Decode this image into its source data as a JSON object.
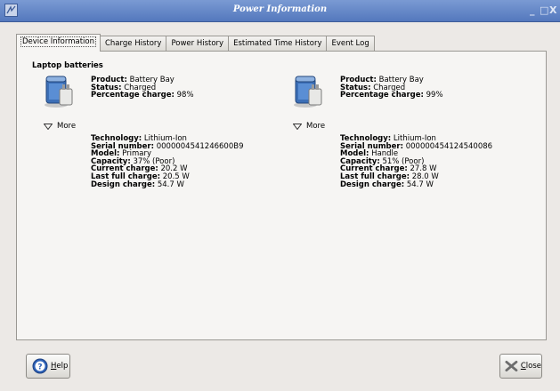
{
  "window": {
    "title": "Power Information",
    "controls": {
      "minimize": "_",
      "maximize": "□",
      "close": "X"
    }
  },
  "tabs": [
    {
      "label": "Device Information",
      "active": true
    },
    {
      "label": "Charge History",
      "active": false
    },
    {
      "label": "Power History",
      "active": false
    },
    {
      "label": "Estimated Time History",
      "active": false
    },
    {
      "label": "Event Log",
      "active": false
    }
  ],
  "section_title": "Laptop batteries",
  "batteries": [
    {
      "product_label": "Product:",
      "product": "Battery Bay",
      "status_label": "Status:",
      "status": "Charged",
      "percentage_label": "Percentage charge:",
      "percentage": "98%",
      "more_label": "More",
      "technology_label": "Technology:",
      "technology": "Lithium-Ion",
      "serial_label": "Serial number:",
      "serial": "0000004541246600B9",
      "model_label": "Model:",
      "model": "Primary",
      "capacity_label": "Capacity:",
      "capacity": "37% (Poor)",
      "current_label": "Current charge:",
      "current": "20.2 W",
      "lastfull_label": "Last full charge:",
      "lastfull": "20.5 W",
      "design_label": "Design charge:",
      "design": "54.7 W"
    },
    {
      "product_label": "Product:",
      "product": "Battery Bay",
      "status_label": "Status:",
      "status": "Charged",
      "percentage_label": "Percentage charge:",
      "percentage": "99%",
      "more_label": "More",
      "technology_label": "Technology:",
      "technology": "Lithium-Ion",
      "serial_label": "Serial number:",
      "serial": "000000454124540086",
      "model_label": "Model:",
      "model": "Handle",
      "capacity_label": "Capacity:",
      "capacity": "51% (Poor)",
      "current_label": "Current charge:",
      "current": "27.8 W",
      "lastfull_label": "Last full charge:",
      "lastfull": "28.0 W",
      "design_label": "Design charge:",
      "design": "54.7 W"
    }
  ],
  "buttons": {
    "help": {
      "mnemonic": "H",
      "rest": "elp",
      "icon": "help-icon"
    },
    "close": {
      "mnemonic": "C",
      "rest": "lose",
      "icon": "close-icon"
    }
  },
  "colors": {
    "titlebar": "#5d80c4",
    "panel": "#f6f5f3",
    "window_bg": "#ece9e6"
  }
}
